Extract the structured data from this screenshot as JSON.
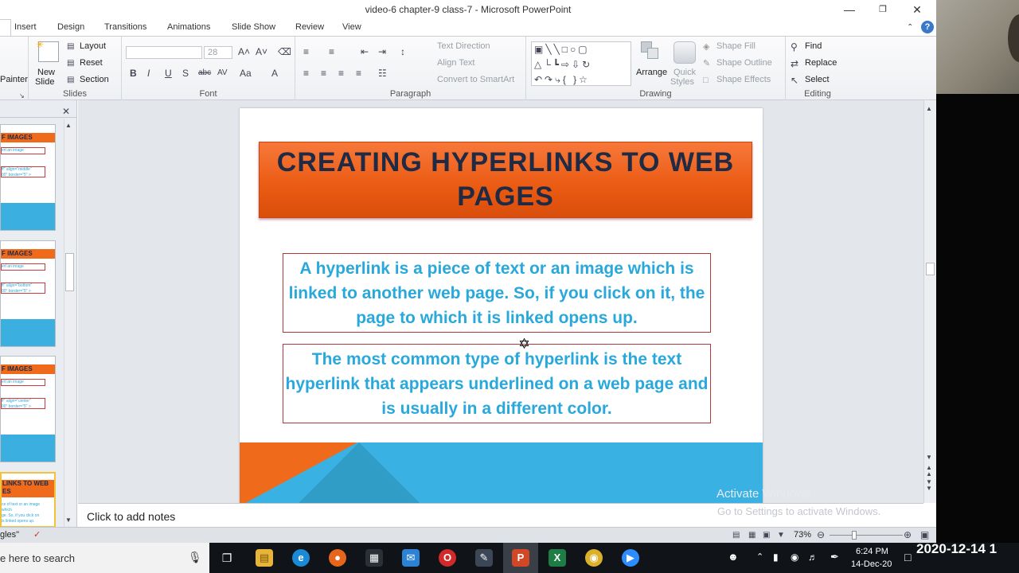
{
  "window": {
    "title": "video-6 chapter-9 class-7  -  Microsoft PowerPoint"
  },
  "tabs": [
    "Insert",
    "Design",
    "Transitions",
    "Animations",
    "Slide Show",
    "Review",
    "View"
  ],
  "ribbon": {
    "clipboard": {
      "painter": "Painter"
    },
    "slides": {
      "label": "Slides",
      "new_slide_1": "New",
      "new_slide_2": "Slide",
      "layout": "Layout",
      "reset": "Reset",
      "section": "Section"
    },
    "font": {
      "label": "Font",
      "size": "28"
    },
    "paragraph": {
      "label": "Paragraph",
      "text_direction": "Text Direction",
      "align_text": "Align Text",
      "convert_smartart": "Convert to SmartArt"
    },
    "drawing": {
      "label": "Drawing",
      "arrange": "Arrange",
      "quick_styles_1": "Quick",
      "quick_styles_2": "Styles",
      "shape_fill": "Shape Fill",
      "shape_outline": "Shape Outline",
      "shape_effects": "Shape Effects"
    },
    "editing": {
      "label": "Editing",
      "find": "Find",
      "replace": "Replace",
      "select": "Select"
    }
  },
  "thumbnails": [
    {
      "title": "F IMAGES",
      "line1": "ert an image",
      "line2": "ff\" align=\"middle\"",
      "line3": "00\" border=\"5\" >"
    },
    {
      "title": "F IMAGES",
      "line1": "ert an image",
      "line2": "ff\" align=\"bottom\"",
      "line3": "00\" border=\"5\" >"
    },
    {
      "title": "F IMAGES",
      "line1": "ert an image",
      "line2": "ff\" align=\"center\"",
      "line3": "00\" border=\"5\" >"
    },
    {
      "title": "LINKS TO WEB",
      "title2": "ES",
      "line1": "ce of text or an image which",
      "line2": "ge. So, if you click on",
      "line3": "is linked opens up."
    }
  ],
  "slide": {
    "title": "CREATING HYPERLINKS TO WEB PAGES",
    "para1": "A hyperlink is a piece of text or an image which is linked to another web page. So, if you click on it, the page to which it is linked opens up.",
    "para2": "The most common type of hyperlink is the text hyperlink that appears underlined on a web page and is usually in a different color."
  },
  "notes": {
    "placeholder": "Click to add notes"
  },
  "watermark": {
    "line1": "Activate Windows",
    "line2": "Go to Settings to activate Windows."
  },
  "status": {
    "left": "gles\"",
    "zoom": "73%"
  },
  "taskbar": {
    "search": "e here to search",
    "time": "6:24 PM",
    "date": "14-Dec-20",
    "overlay_date": "2020-12-14  1"
  },
  "colors": {
    "orange": "#f06a1c",
    "blue": "#3ab1e3",
    "navy": "#1f2a44",
    "text_blue": "#29a8dc"
  }
}
